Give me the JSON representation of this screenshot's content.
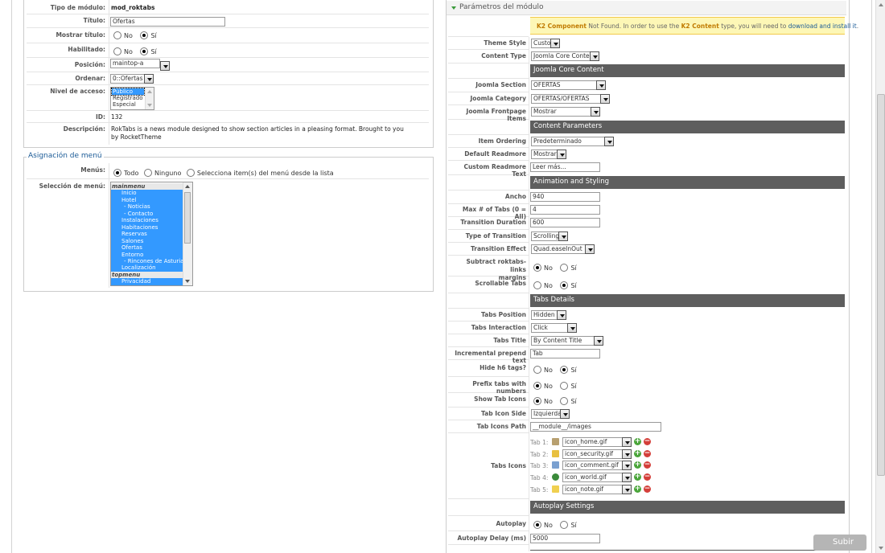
{
  "left": {
    "details": {
      "rows": [
        {
          "label": "Tipo de módulo:",
          "value": "mod_roktabs"
        },
        {
          "label": "Título:",
          "value": "Ofertas"
        },
        {
          "label": "Mostrar título:",
          "no": "No",
          "si": "Sí"
        },
        {
          "label": "Habilitado:",
          "no": "No",
          "si": "Sí"
        },
        {
          "label": "Posición:",
          "value": "maintop-a"
        },
        {
          "label": "Ordenar:",
          "value": "0::Ofertas"
        },
        {
          "label": "Nivel de acceso:",
          "options": [
            "Público",
            "Registrado",
            "Especial"
          ]
        },
        {
          "label": "ID:",
          "value": "132"
        },
        {
          "label": "Descripción:",
          "value": "RokTabs is a news module designed to show section articles in a pleasing format. Brought to you by RocketTheme"
        }
      ]
    },
    "menu": {
      "legend": "Asignación de menú",
      "menus_label": "Menús:",
      "opt_todo": "Todo",
      "opt_ninguno": "Ninguno",
      "opt_select": "Selecciona item(s) del menú desde la lista",
      "selection_label": "Selección de menú:",
      "items": [
        {
          "text": "mainmenu",
          "type": "group"
        },
        {
          "text": "Inicio",
          "type": "item"
        },
        {
          "text": "Hotel",
          "type": "item"
        },
        {
          "text": "- Noticias",
          "type": "sub"
        },
        {
          "text": "- Contacto",
          "type": "sub"
        },
        {
          "text": "Instalaciones",
          "type": "item"
        },
        {
          "text": "Habitaciones",
          "type": "item"
        },
        {
          "text": "Reservas",
          "type": "item"
        },
        {
          "text": "Salones",
          "type": "item"
        },
        {
          "text": "Ofertas",
          "type": "item"
        },
        {
          "text": "Entorno",
          "type": "item"
        },
        {
          "text": "- Rincones de Asturias",
          "type": "sub"
        },
        {
          "text": "Localización",
          "type": "item"
        },
        {
          "text": "topmenu",
          "type": "group"
        },
        {
          "text": "Privacidad",
          "type": "item"
        }
      ]
    }
  },
  "right": {
    "panel_title": "Parámetros del módulo",
    "notice": {
      "k2": "K2 Component",
      "not_found": " Not Found. In order to use the ",
      "k2c": "K2 Content",
      "type": " type, you will need to ",
      "link": "download and install it",
      "end": "."
    },
    "theme_style": {
      "label": "Theme Style",
      "value": "Custom"
    },
    "content_type": {
      "label": "Content Type",
      "value": "Joomla Core Content"
    },
    "sec_core": "Joomla Core Content",
    "joomla_section": {
      "label": "Joomla Section",
      "value": "OFERTAS"
    },
    "joomla_category": {
      "label": "Joomla Category",
      "value": "OFERTAS/OFERTAS"
    },
    "frontpage_items": {
      "label": "Joomla Frontpage Items",
      "value": "Mostrar"
    },
    "sec_content": "Content Parameters",
    "item_ordering": {
      "label": "Item Ordering",
      "value": "Predeterminado"
    },
    "default_readmore": {
      "label": "Default Readmore",
      "value": "Mostrar"
    },
    "custom_readmore": {
      "label": "Custom Readmore Text",
      "value": "Leer más..."
    },
    "sec_anim": "Animation and Styling",
    "ancho": {
      "label": "Ancho",
      "value": "940"
    },
    "max_tabs": {
      "label": "Max # of Tabs (0 = All)",
      "value": "4"
    },
    "trans_duration": {
      "label": "Transition Duration",
      "value": "600"
    },
    "trans_type": {
      "label": "Type of Transition",
      "value": "Scrolling"
    },
    "trans_effect": {
      "label": "Transition Effect",
      "value": "Quad.easeInOut"
    },
    "subtract": {
      "label1": "Subtract roktabs-links",
      "label2": "margins",
      "no": "No",
      "si": "Sí"
    },
    "scrollable": {
      "label": "Scrollable Tabs",
      "no": "No",
      "si": "Sí"
    },
    "sec_tabs": "Tabs Details",
    "tabs_position": {
      "label": "Tabs Position",
      "value": "Hidden"
    },
    "tabs_interaction": {
      "label": "Tabs Interaction",
      "value": "Click"
    },
    "tabs_title": {
      "label": "Tabs Title",
      "value": "By Content Title"
    },
    "prepend_text": {
      "label": "Incremental prepend text",
      "value": "Tab"
    },
    "hide_h6": {
      "label": "Hide h6 tags?",
      "no": "No",
      "si": "Sí"
    },
    "prefix_numbers": {
      "label": "Prefix tabs with numbers",
      "no": "No",
      "si": "Sí"
    },
    "show_icons": {
      "label": "Show Tab Icons",
      "no": "No",
      "si": "Sí"
    },
    "icon_side": {
      "label": "Tab Icon Side",
      "value": "Izquierda"
    },
    "icons_path": {
      "label": "Tab Icons Path",
      "value": "__module__/images"
    },
    "tabs_icons": {
      "label": "Tabs Icons",
      "items": [
        {
          "tab": "Tab 1:",
          "file": "icon_home.gif",
          "icon": "home-icon"
        },
        {
          "tab": "Tab 2:",
          "file": "icon_security.gif",
          "icon": "security-icon"
        },
        {
          "tab": "Tab 3:",
          "file": "icon_comment.gif",
          "icon": "comment-icon"
        },
        {
          "tab": "Tab 4:",
          "file": "icon_world.gif",
          "icon": "world-icon"
        },
        {
          "tab": "Tab 5:",
          "file": "icon_note.gif",
          "icon": "note-icon"
        }
      ]
    },
    "sec_autoplay": "Autoplay Settings",
    "autoplay": {
      "label": "Autoplay",
      "no": "No",
      "si": "Sí"
    },
    "autoplay_delay": {
      "label": "Autoplay Delay (ms)",
      "value": "5000"
    }
  },
  "subir_label": "Subir"
}
